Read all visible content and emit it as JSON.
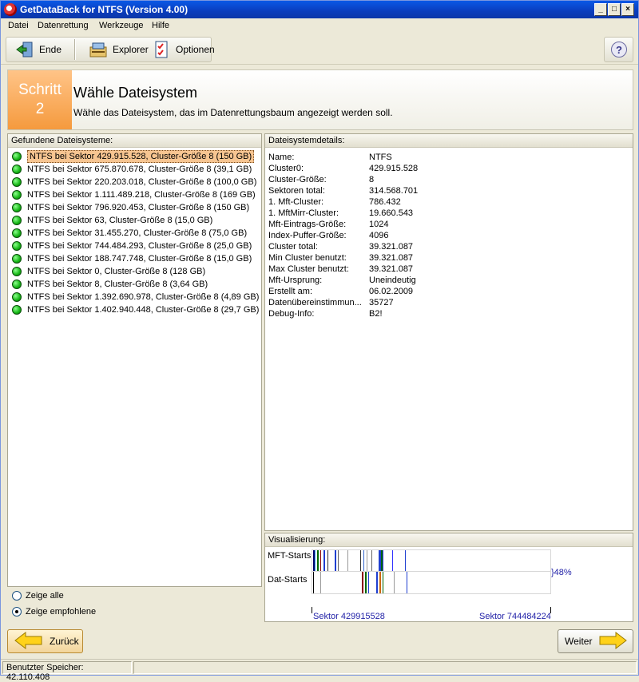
{
  "window": {
    "title": "GetDataBack for NTFS (Version 4.00)",
    "minimize": "_",
    "maximize": "□",
    "close": "×"
  },
  "menu": [
    {
      "label": "Datei"
    },
    {
      "label": "Datenrettung"
    },
    {
      "label": "Werkzeuge"
    },
    {
      "label": "Hilfe"
    }
  ],
  "toolbar": {
    "exit_label": "Ende",
    "explorer_label": "Explorer",
    "options_label": "Optionen",
    "help_label": "?"
  },
  "step": {
    "badge_word": "Schritt",
    "badge_number": "2",
    "title": "Wähle Dateisystem",
    "description": "Wähle das Dateisystem, das im Datenrettungsbaum angezeigt werden soll."
  },
  "filesystems": {
    "header": "Gefundene Dateisysteme:",
    "items": [
      "NTFS bei Sektor 429.915.528, Cluster-Größe 8 (150 GB)",
      "NTFS bei Sektor 675.870.678, Cluster-Größe 8 (39,1 GB)",
      "NTFS bei Sektor 220.203.018, Cluster-Größe 8 (100,0 GB)",
      "NTFS bei Sektor 1.111.489.218, Cluster-Größe 8 (169 GB)",
      "NTFS bei Sektor 796.920.453, Cluster-Größe 8 (150 GB)",
      "NTFS bei Sektor 63, Cluster-Größe 8 (15,0 GB)",
      "NTFS bei Sektor 31.455.270, Cluster-Größe 8 (75,0 GB)",
      "NTFS bei Sektor 744.484.293, Cluster-Größe 8 (25,0 GB)",
      "NTFS bei Sektor 188.747.748, Cluster-Größe 8 (15,0 GB)",
      "NTFS bei Sektor 0, Cluster-Größe 8 (128 GB)",
      "NTFS bei Sektor 8, Cluster-Größe 8 (3,64 GB)",
      "NTFS bei Sektor 1.392.690.978, Cluster-Größe 8 (4,89 GB)",
      "NTFS bei Sektor 1.402.940.448, Cluster-Größe 8 (29,7 GB)"
    ],
    "selected_index": 0,
    "status_color": "#14b514"
  },
  "display_options": {
    "show_all": "Zeige alle",
    "show_recommended": "Zeige empfohlene",
    "selected": "show_recommended"
  },
  "details": {
    "header": "Dateisystemdetails:",
    "rows": [
      {
        "k": "Name:",
        "v": "NTFS"
      },
      {
        "k": "Cluster0:",
        "v": "429.915.528"
      },
      {
        "k": "Cluster-Größe:",
        "v": "8"
      },
      {
        "k": "Sektoren total:",
        "v": "314.568.701"
      },
      {
        "k": "1. Mft-Cluster:",
        "v": "786.432"
      },
      {
        "k": "1. MftMirr-Cluster:",
        "v": "19.660.543"
      },
      {
        "k": "Mft-Eintrags-Größe:",
        "v": "1024"
      },
      {
        "k": "Index-Puffer-Größe:",
        "v": "4096"
      },
      {
        "k": "Cluster total:",
        "v": "39.321.087"
      },
      {
        "k": "Min Cluster benutzt:",
        "v": "39.321.087"
      },
      {
        "k": "Max Cluster benutzt:",
        "v": "39.321.087"
      },
      {
        "k": "Mft-Ursprung:",
        "v": "Uneindeutig"
      },
      {
        "k": "Erstellt am:",
        "v": "06.02.2009"
      },
      {
        "k": "Datenübereinstimmun...",
        "v": "35727"
      },
      {
        "k": "Debug-Info:",
        "v": "B2!"
      }
    ]
  },
  "visualization": {
    "header": "Visualisierung:",
    "mft_label": "MFT-Starts",
    "dat_label": "Dat-Starts",
    "percent": "}48%",
    "sector_start": "Sektor 429915528",
    "sector_end": "Sektor 744484224"
  },
  "navigation": {
    "back_label": "Zurück",
    "next_label": "Weiter"
  },
  "status": {
    "memory": "Benutzter Speicher: 42.110.408"
  },
  "colors": {
    "accent_orange": "#f59a3e",
    "selection": "#f7c591",
    "link_blue": "#2323a8"
  }
}
